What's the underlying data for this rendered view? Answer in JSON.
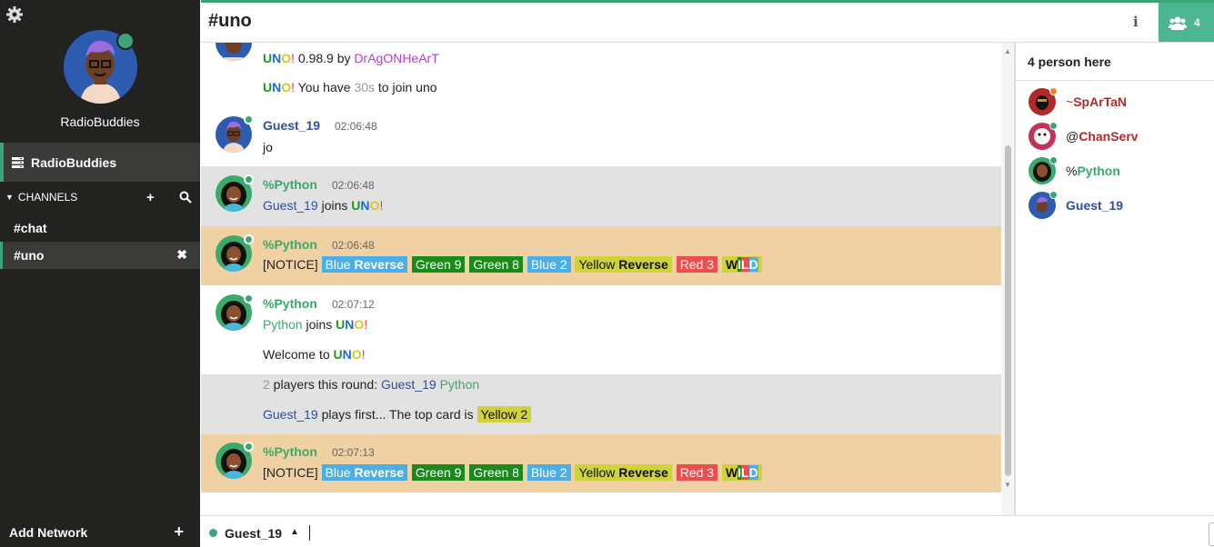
{
  "profile": {
    "name": "RadioBuddies"
  },
  "network": {
    "label": "RadioBuddies"
  },
  "channels": {
    "header": "CHANNELS",
    "items": [
      {
        "label": "#chat"
      },
      {
        "label": "#uno",
        "active": true
      }
    ]
  },
  "add_network": {
    "label": "Add Network"
  },
  "header": {
    "title": "#uno",
    "user_count": "4",
    "info_glyph": "i"
  },
  "messages": {
    "m1": {
      "uno": [
        "U",
        "N",
        "O",
        "!"
      ],
      "version": " 0.98.9 by ",
      "author": "DrAgONHeArT"
    },
    "m2": {
      "uno": [
        "U",
        "N",
        "O",
        "!"
      ],
      "pre": " You have ",
      "secs": "30s",
      "post": " to join uno"
    },
    "m3": {
      "nick": "Guest_19",
      "time": "02:06:48",
      "text": "jo"
    },
    "m4": {
      "nick": "%Python",
      "time": "02:06:48",
      "who": "Guest_19",
      "mid": " joins ",
      "uno": [
        "U",
        "N",
        "O",
        "!"
      ]
    },
    "m5": {
      "nick": "%Python",
      "time": "02:06:48",
      "notice": "[NOTICE]"
    },
    "m6": {
      "nick": "%Python",
      "time": "02:07:12",
      "who": "Python",
      "mid": " joins ",
      "uno": [
        "U",
        "N",
        "O",
        "!"
      ]
    },
    "m7": {
      "pre": "Welcome to ",
      "uno": [
        "U",
        "N",
        "O",
        "!"
      ]
    },
    "m8": {
      "count": "2",
      "mid": " players this round: ",
      "p1": "Guest_19",
      "p2": "Python"
    },
    "m9": {
      "who": "Guest_19",
      "mid": " plays first... The top card is ",
      "card": "Yellow 2"
    },
    "m10": {
      "nick": "%Python",
      "time": "02:07:13",
      "notice": "[NOTICE]"
    }
  },
  "hand": {
    "blue_rev": [
      "Blue",
      "Reverse"
    ],
    "green9": "Green 9",
    "green8": "Green 8",
    "blue2": "Blue 2",
    "yellow_rev": [
      "Yellow",
      "Reverse"
    ],
    "red3": "Red 3",
    "wild": [
      "W",
      "I",
      "L",
      "D"
    ]
  },
  "colors": {
    "accent": "#3fa37a",
    "uno_u": "#1e9a1e",
    "uno_n": "#1e6bd6",
    "uno_o": "#d6c81e",
    "uno_excl": "#e03b3b"
  },
  "userlist": {
    "title": "4 person here",
    "users": [
      {
        "prefix": "~",
        "name": "SpArTaN",
        "color": "#b02a2a",
        "dot": "#e08a2a",
        "icon": "avatar-spartan"
      },
      {
        "prefix": "@",
        "name": "ChanServ",
        "color": "#b02a2a",
        "dot": "#3fa37a",
        "icon": "avatar-chanserv"
      },
      {
        "prefix": "%",
        "name": "Python",
        "color": "#3aaa6a",
        "dot": "#3fa37a",
        "icon": "avatar-python"
      },
      {
        "prefix": "",
        "name": "Guest_19",
        "color": "#2d4f9e",
        "dot": "#3fa37a",
        "icon": "avatar-guest"
      }
    ]
  },
  "input": {
    "nick": "Guest_19"
  }
}
